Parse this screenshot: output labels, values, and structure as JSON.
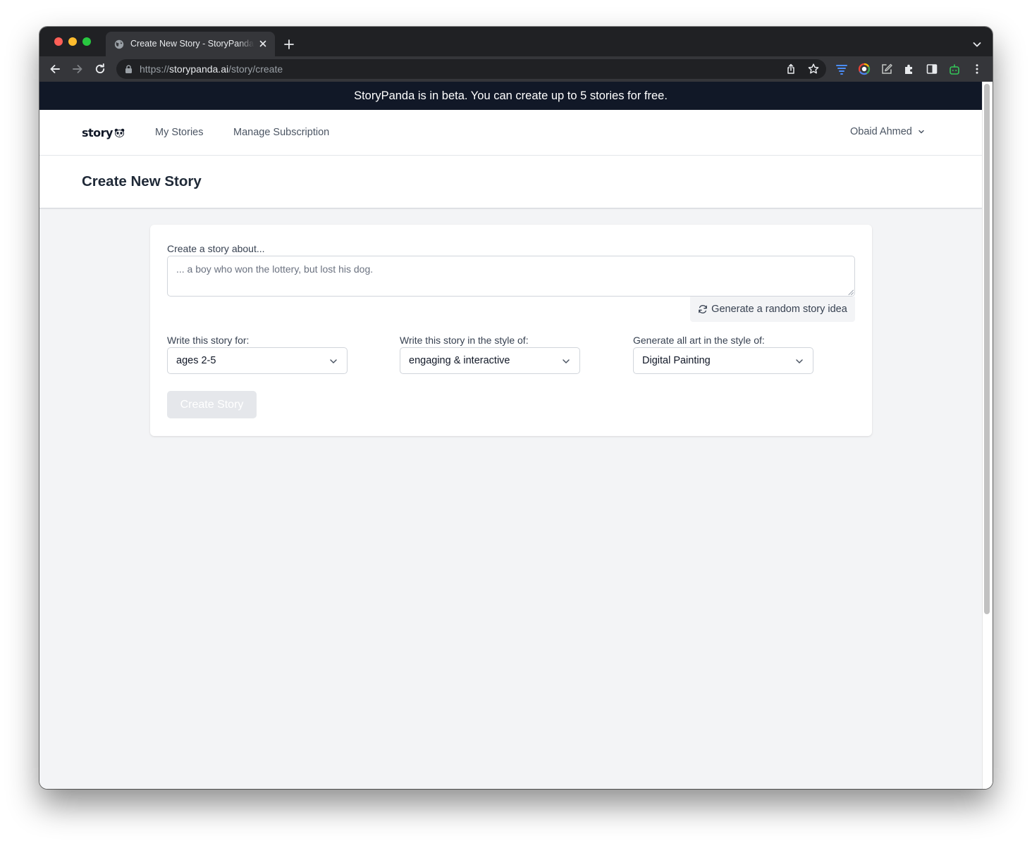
{
  "browser": {
    "tab_title": "Create New Story - StoryPanda",
    "url_scheme": "https://",
    "url_host": "storypanda.ai",
    "url_path": "/story/create"
  },
  "banner": {
    "text": "StoryPanda is in beta. You can create up to 5 stories for free."
  },
  "nav": {
    "logo_text": "story",
    "links": [
      "My Stories",
      "Manage Subscription"
    ],
    "user_name": "Obaid Ahmed"
  },
  "header": {
    "title": "Create New Story"
  },
  "form": {
    "prompt_label": "Create a story about...",
    "prompt_placeholder": "... a boy who won the lottery, but lost his dog.",
    "prompt_value": "",
    "random_button": "Generate a random story idea",
    "audience_label": "Write this story for:",
    "audience_value": "ages 2-5",
    "style_label": "Write this story in the style of:",
    "style_value": "engaging & interactive",
    "art_label": "Generate all art in the style of:",
    "art_value": "Digital Painting",
    "create_button": "Create Story"
  },
  "colors": {
    "banner_bg": "#111827",
    "page_bg": "#f3f4f6",
    "disabled_button_bg": "#e5e7eb"
  },
  "icons": {
    "toolbar": [
      "back-icon",
      "forward-icon",
      "reload-icon"
    ],
    "omnibox": [
      "share-icon",
      "bookmark-star-icon"
    ],
    "extensions": [
      "extension-filter-icon",
      "extension-color-icon",
      "extension-edit-icon",
      "extensions-puzzle-icon",
      "side-panel-icon",
      "extension-bot-icon",
      "more-menu-icon"
    ]
  }
}
